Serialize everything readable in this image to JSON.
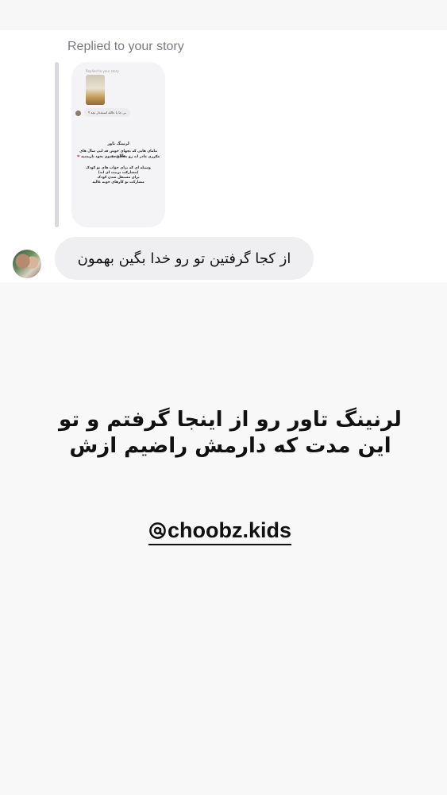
{
  "dm": {
    "replied_label": "Replied to your story",
    "story_preview": {
      "header_label": "Replied to your story",
      "reply_text": "بی جا یا حالله استخدار بچه ؟",
      "title": "لرنینگ تاور",
      "paragraph1": "مامان هایی که بچهای خوش قد لبی سال های طلایی و",
      "paragraph1b": "مکرری مادر اند رو تستین میدون بخود تاریمتیه",
      "heart": "❤",
      "paragraph2a": "وسیله ای که برای خواب های تو کودک",
      "paragraph2b": "(مشارکت تربیت ای اند)",
      "paragraph2c": "برای مستقل شدن کودک",
      "paragraph2d": "مشارکت تو کارهای خونه عالیه"
    },
    "message": "از کجا گرفتین تو رو خدا بگین بهمون"
  },
  "story": {
    "headline_line1": "لرنینگ تاور رو از اینجا گرفتم و تو",
    "headline_line2": "این مدت که دارمش راضیم ازش",
    "mention": "choobz.kids",
    "mention_icon": "threads-at-icon"
  }
}
